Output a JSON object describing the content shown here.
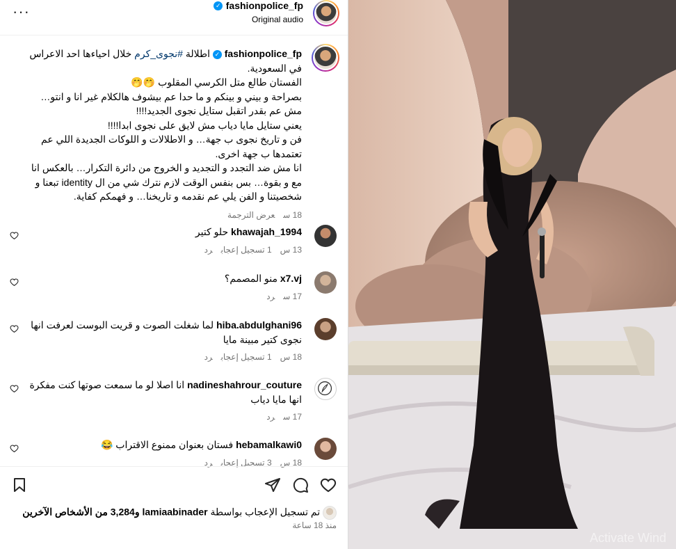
{
  "header": {
    "username": "fashionpolice_fp",
    "audio": "Original audio",
    "more_label": "···"
  },
  "caption": {
    "username": "fashionpolice_fp",
    "line1_pre": "اطلالة ",
    "hashtag": "#نجوى_كرم",
    "line1_post": " خلال احياءها احد الاعراس في السعودية.",
    "line2": "الفستان طالع متل الكرسي المقلوب 🤭🤭",
    "line3": "بصراحة و بيني و بينكم و ما حدا عم بيشوف هالكلام غير انا و انتو… مش عم بقدر اتقبل ستايل نجوى الجديد!!!!",
    "line4": "يعني ستايل مايا دياب مش لايق على نجوى ابدا!!!!",
    "line5": "فن و تاريخ نجوى ب جهة… و الاطلالات و اللوكات الجديدة اللي عم تعتمدها ب جهة اخرى.",
    "line6": "انا مش ضد التجدد و التجديد و الخروج من دائرة التكرار… بالعكس انا مع و بقوة… بس بنفس الوقت لازم نترك شي من ال identity تبعنا و شخصيتنا و الفن يلي عم نقدمه و تاريخنا… و فهمكم كفاية.",
    "time": "18 س",
    "translate": "عرض الترجمة"
  },
  "comments": [
    {
      "username": "khawajah_1994",
      "text": "حلو كتير",
      "time": "13 س",
      "likes": "1 تسجيل إعجاب",
      "reply": "رد"
    },
    {
      "username": "x7.vj",
      "text": "منو المصمم؟",
      "time": "17 س",
      "likes": "",
      "reply": "رد"
    },
    {
      "username": "hiba.abdulghani96",
      "text": "لما شغلت الصوت و قريت البوست لعرفت انها نجوى كتير مبينة مايا",
      "time": "18 س",
      "likes": "1 تسجيل إعجاب",
      "reply": "رد"
    },
    {
      "username": "nadineshahrour_couture",
      "text": "انا اصلا لو ما سمعت صوتها كنت مفكرة انها مايا دياب",
      "time": "17 س",
      "likes": "",
      "reply": "رد"
    },
    {
      "username": "hebamalkawi0",
      "text": "فستان بعنوان ممنوع الاقتراب 😂",
      "time": "18 س",
      "likes": "3 تسجيل إعجاب",
      "reply": "رد"
    }
  ],
  "likes": {
    "prefix": "تم تسجيل الإعجاب بواسطة ",
    "user": "lamiaabinader",
    "suffix": " و3,284 من الأشخاص الآخرين"
  },
  "time_ago": "منذ 18 ساعة",
  "watermark": "Activate Wind",
  "icons": {
    "heart": "heart-icon",
    "comment": "comment-icon",
    "share": "send-icon",
    "save": "bookmark-icon"
  },
  "colors": {
    "link": "#00376b",
    "verified": "#0095f6",
    "muted": "#737373"
  }
}
